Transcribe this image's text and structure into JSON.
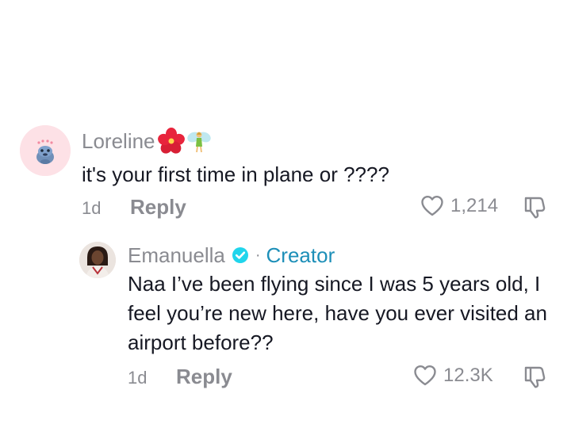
{
  "comments": [
    {
      "username": "Loreline",
      "emojis": "🌺🧚",
      "text": "it's your first time in plane or ????",
      "time": "1d",
      "reply_label": "Reply",
      "likes": "1,214"
    },
    {
      "username": "Emanuella",
      "badge_separator": "·",
      "badge_label": "Creator",
      "text": "Naa I’ve been flying since I was 5 years old, I feel you’re new here, have you ever visited an airport before??",
      "time": "1d",
      "reply_label": "Reply",
      "likes": "12.3K"
    }
  ],
  "colors": {
    "muted": "#8a8b91",
    "text": "#161823",
    "creator": "#1d8fb8",
    "verified": "#20d5ec"
  }
}
